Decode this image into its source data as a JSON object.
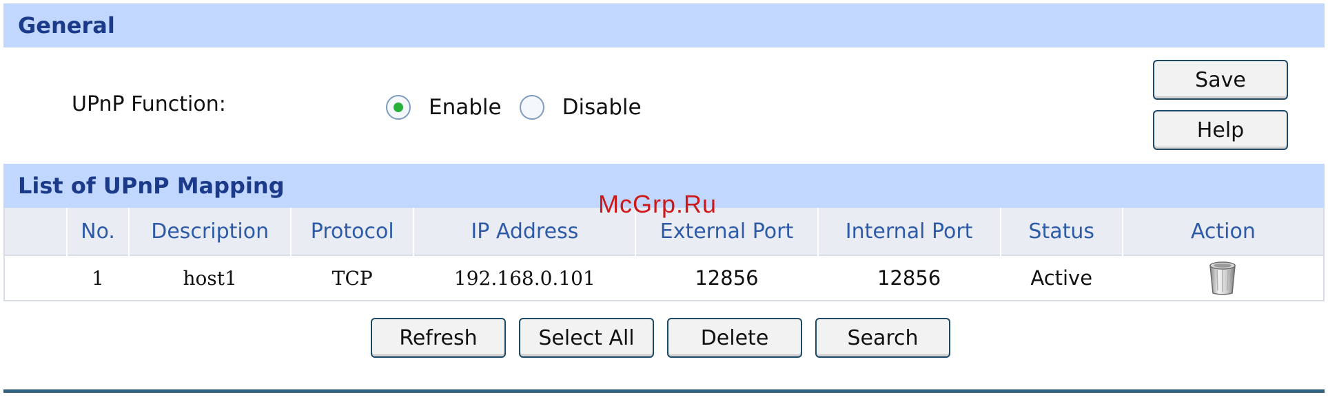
{
  "general": {
    "title": "General",
    "upnp_label": "UPnP Function:",
    "enable_label": "Enable",
    "disable_label": "Disable",
    "selected": "Enable",
    "save_label": "Save",
    "help_label": "Help"
  },
  "mapping": {
    "title": "List of UPnP Mapping",
    "columns": [
      "No.",
      "Description",
      "Protocol",
      "IP Address",
      "External Port",
      "Internal Port",
      "Status",
      "Action"
    ],
    "rows": [
      {
        "no": "1",
        "description": "host1",
        "protocol": "TCP",
        "ip": "192.168.0.101",
        "external_port": "12856",
        "internal_port": "12856",
        "status": "Active",
        "action_icon": "trash-icon"
      }
    ],
    "buttons": {
      "refresh": "Refresh",
      "select_all": "Select All",
      "delete": "Delete",
      "search": "Search"
    }
  },
  "watermark": "McGrp.Ru",
  "colors": {
    "header_bg": "#c2d7fd",
    "header_text": "#1b3b8a",
    "table_header_text": "#2e5ba8",
    "radio_selected": "#28b13a",
    "bottom_rule": "#33637f"
  }
}
